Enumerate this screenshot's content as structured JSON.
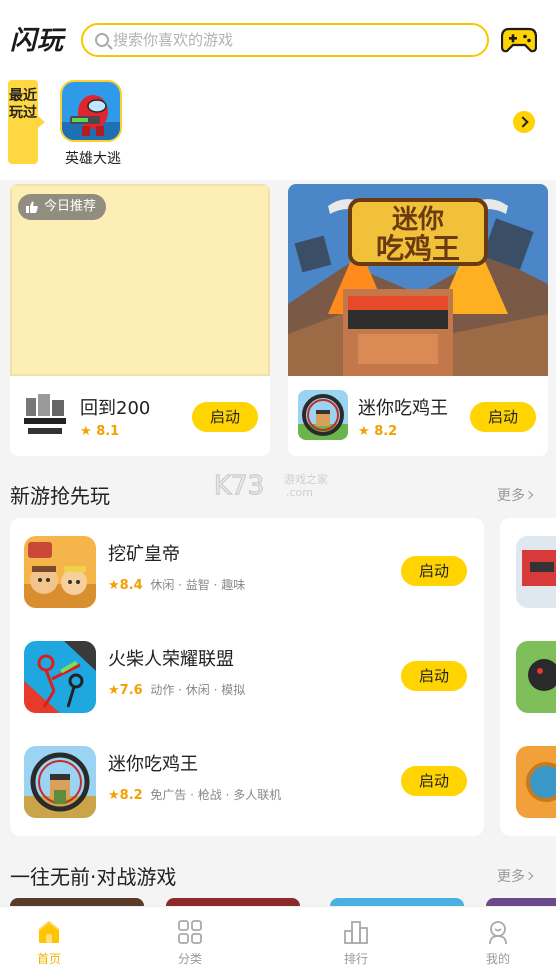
{
  "header": {
    "logo": "闪玩",
    "search_placeholder": "搜索你喜欢的游戏",
    "search_icon": "search-icon",
    "gamepad_icon": "gamepad-icon"
  },
  "recent": {
    "tag": "最近玩过",
    "games": [
      {
        "name": "英雄大逃"
      }
    ],
    "arrow_icon": "chevron-right-icon"
  },
  "featured": {
    "badge": "今日推荐",
    "cards": [
      {
        "name": "回到200",
        "rating": "8.1",
        "button": "启动"
      },
      {
        "name": "迷你吃鸡王",
        "rating": "8.2",
        "button": "启动",
        "banner_title": "迷你吃鸡王"
      }
    ]
  },
  "new_games": {
    "title": "新游抢先玩",
    "more": "更多",
    "items": [
      {
        "name": "挖矿皇帝",
        "rating": "8.4",
        "tags": "休闲 · 益智 · 趣味",
        "button": "启动"
      },
      {
        "name": "火柴人荣耀联盟",
        "rating": "7.6",
        "tags": "动作 · 休闲 · 模拟",
        "button": "启动"
      },
      {
        "name": "迷你吃鸡王",
        "rating": "8.2",
        "tags": "免广告 · 枪战 · 多人联机",
        "button": "启动"
      }
    ]
  },
  "battle_games": {
    "title": "一往无前·对战游戏",
    "more": "更多"
  },
  "watermark": {
    "text": "K73",
    "subtext": "游戏之家",
    "domain": ".com"
  },
  "tabbar": {
    "tabs": [
      {
        "label": "首页",
        "icon": "home-icon",
        "active": true
      },
      {
        "label": "分类",
        "icon": "category-icon",
        "active": false
      },
      {
        "label": "排行",
        "icon": "ranking-icon",
        "active": false
      },
      {
        "label": "我的",
        "icon": "profile-icon",
        "active": false
      }
    ]
  },
  "colors": {
    "accent": "#ffd400",
    "rating": "#f2a100",
    "background": "#f4f4f4"
  }
}
